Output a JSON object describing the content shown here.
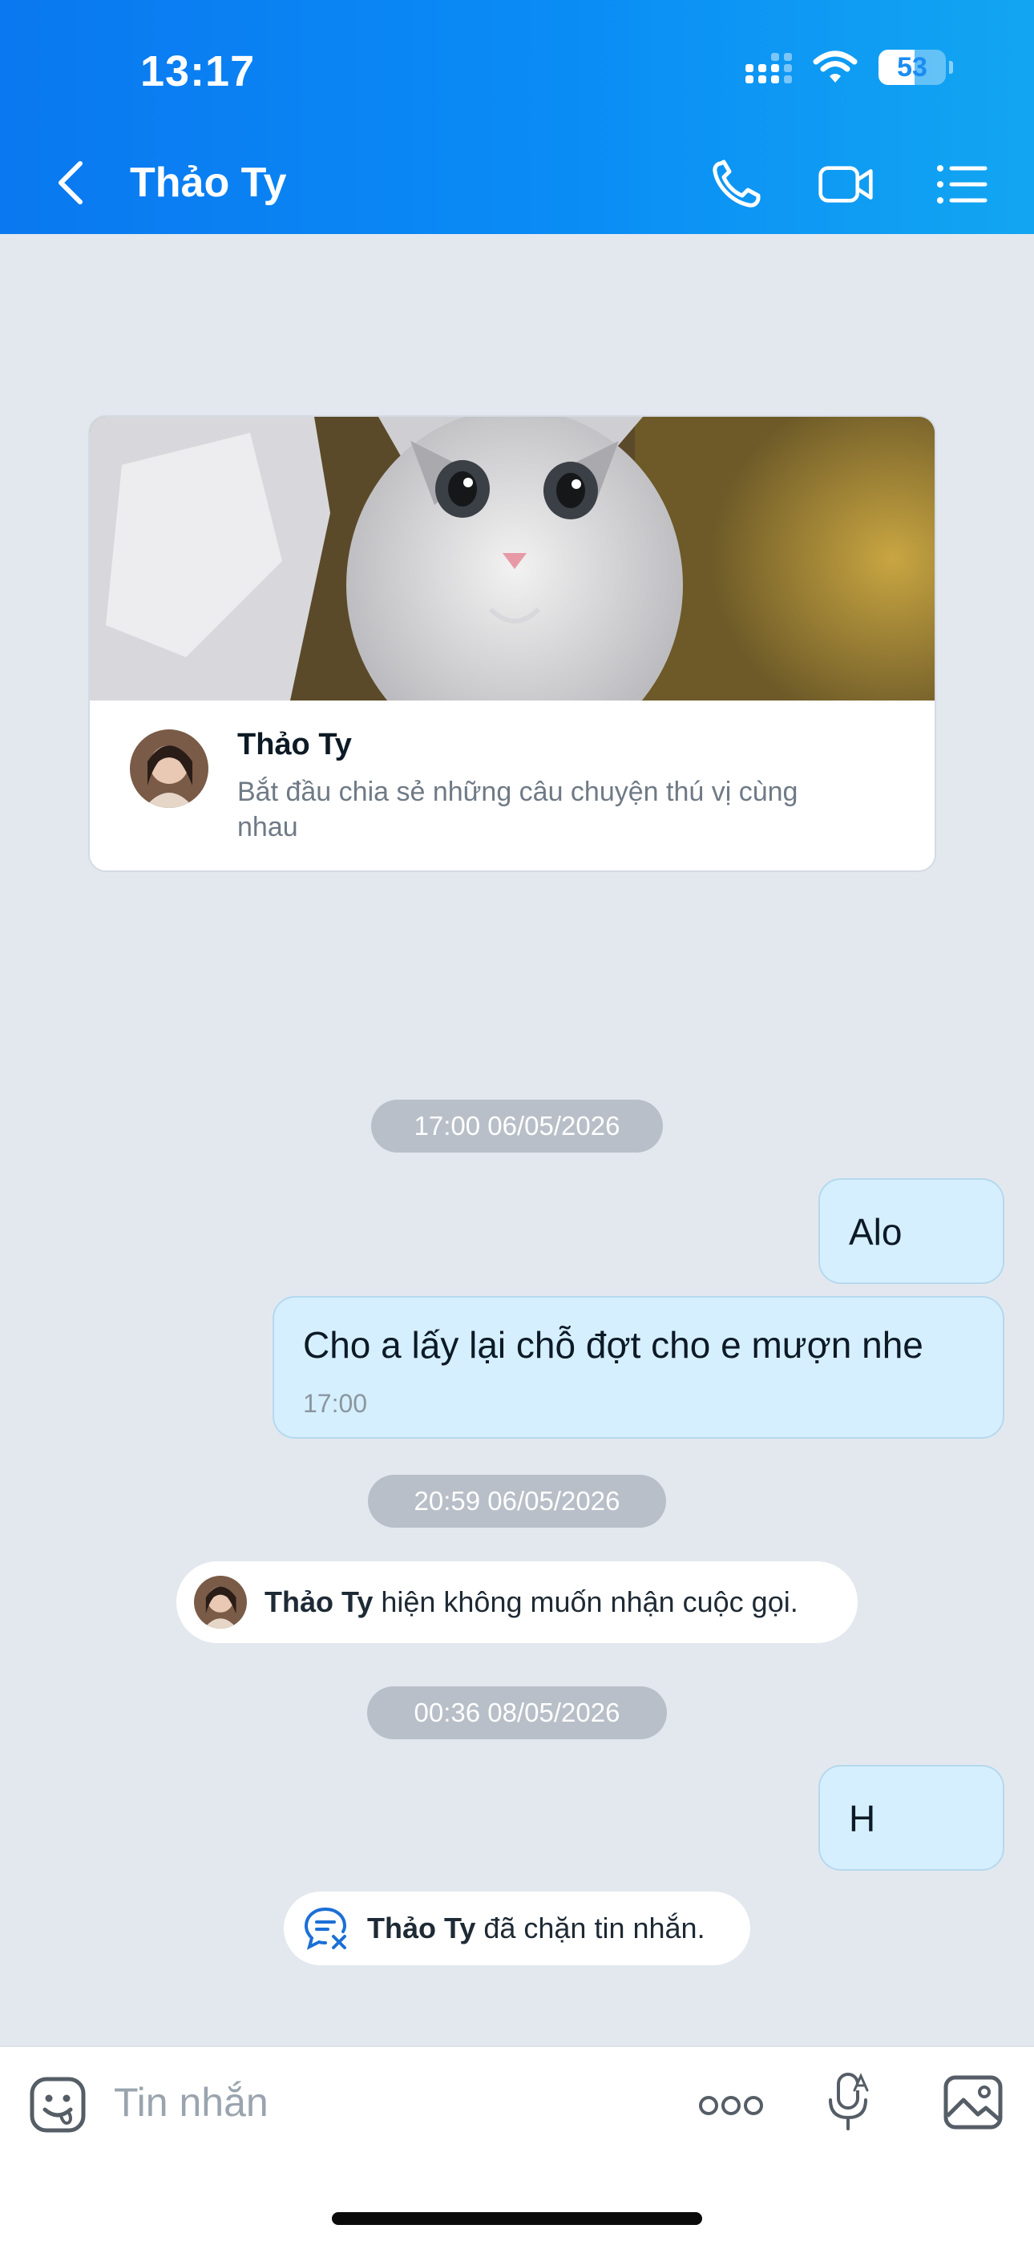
{
  "status_bar": {
    "time": "13:17",
    "battery": "53",
    "battery_level": 0.53
  },
  "header": {
    "title": "Thảo Ty"
  },
  "intro_card": {
    "name": "Thảo Ty",
    "subtitle": "Bắt đầu chia sẻ những câu chuyện thú vị cùng nhau"
  },
  "messages": {
    "time_1": "17:00 06/05/2026",
    "msg_1": "Alo",
    "msg_2": "Cho a lấy lại chỗ đợt cho e mượn nhe",
    "msg_2_time": "17:00",
    "time_2": "20:59 06/05/2026",
    "notice_1": {
      "name": "Thảo Ty",
      "text": " hiện không muốn nhận cuộc gọi."
    },
    "time_3": "00:36 08/05/2026",
    "msg_3": "H",
    "notice_2": {
      "name": "Thảo Ty",
      "text": " đã chặn tin nhắn."
    }
  },
  "input": {
    "placeholder": "Tin nhắn"
  },
  "colors": {
    "header_start": "#0a78f0",
    "header_end": "#12a6f2",
    "bubble": "#d5efff",
    "background": "#e3e8ef"
  },
  "icons": [
    "back-icon",
    "phone-icon",
    "video-call-icon",
    "menu-list-icon",
    "sticker-icon",
    "more-icon",
    "voice-icon",
    "image-icon",
    "chat-blocked-icon"
  ]
}
